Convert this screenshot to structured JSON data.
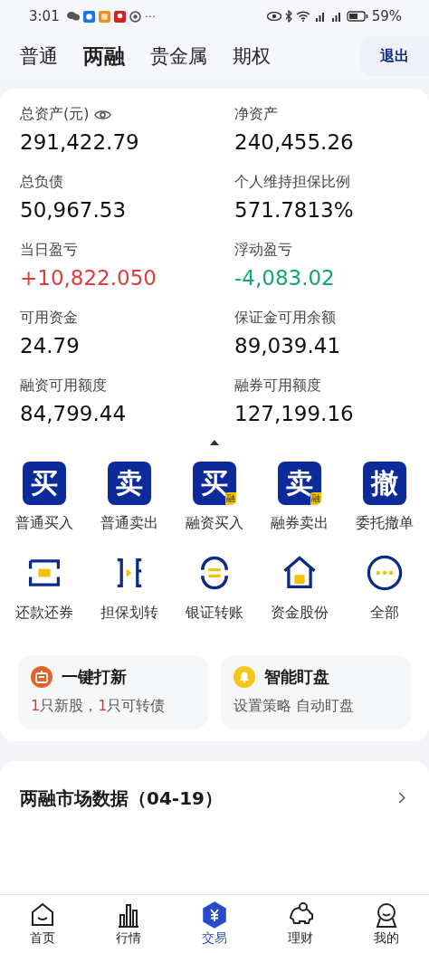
{
  "status_bar": {
    "time": "3:01",
    "more": "···",
    "battery": "59%"
  },
  "tabs": [
    {
      "label": "普通",
      "selected": false
    },
    {
      "label": "两融",
      "selected": true
    },
    {
      "label": "贵金属",
      "selected": false
    },
    {
      "label": "期权",
      "selected": false
    }
  ],
  "logout": "退出",
  "metrics": [
    {
      "label": "总资产(元)",
      "value": "291,422.79",
      "color": "#111111",
      "eye": true
    },
    {
      "label": "净资产",
      "value": "240,455.26",
      "color": "#111111",
      "eye": false
    },
    {
      "label": "总负债",
      "value": "50,967.53",
      "color": "#111111",
      "eye": false
    },
    {
      "label": "个人维持担保比例",
      "value": "571.7813%",
      "color": "#111111",
      "eye": false
    },
    {
      "label": "当日盈亏",
      "value": "+10,822.050",
      "color": "#e03c3c",
      "eye": false
    },
    {
      "label": "浮动盈亏",
      "value": "-4,083.02",
      "color": "#15a66f",
      "eye": false
    },
    {
      "label": "可用资金",
      "value": "24.79",
      "color": "#111111",
      "eye": false
    },
    {
      "label": "保证金可用余额",
      "value": "89,039.41",
      "color": "#111111",
      "eye": false
    },
    {
      "label": "融资可用额度",
      "value": "84,799.44",
      "color": "#111111",
      "eye": false
    },
    {
      "label": "融券可用额度",
      "value": "127,199.16",
      "color": "#111111",
      "eye": false
    }
  ],
  "actions": [
    {
      "kind": "glyph",
      "glyph": "买",
      "label": "普通买入"
    },
    {
      "kind": "glyph",
      "glyph": "卖",
      "label": "普通卖出"
    },
    {
      "kind": "glyph",
      "glyph": "买",
      "badge": "融",
      "label": "融资买入"
    },
    {
      "kind": "glyph",
      "glyph": "卖",
      "badge": "融",
      "label": "融券卖出"
    },
    {
      "kind": "glyph",
      "glyph": "撤",
      "label": "委托撤单"
    },
    {
      "kind": "repay",
      "label": "还款还券"
    },
    {
      "kind": "collateral",
      "label": "担保划转"
    },
    {
      "kind": "bank",
      "label": "银证转账"
    },
    {
      "kind": "assets",
      "label": "资金股份"
    },
    {
      "kind": "more",
      "label": "全部"
    }
  ],
  "tiles": [
    {
      "kind": "ipo",
      "title": "一键打新",
      "subtitle": [
        {
          "text": "1",
          "highlight": true
        },
        {
          "text": "只新股，",
          "highlight": false
        },
        {
          "text": "1",
          "highlight": true
        },
        {
          "text": "只可转债",
          "highlight": false
        }
      ]
    },
    {
      "kind": "alert",
      "title": "智能盯盘",
      "subtitle": [
        {
          "text": "设置策略 自动盯盘",
          "highlight": false
        }
      ]
    }
  ],
  "market_data": {
    "title": "两融市场数据（04-19）"
  },
  "nav": [
    {
      "kind": "home",
      "label": "首页",
      "selected": false
    },
    {
      "kind": "market",
      "label": "行情",
      "selected": false
    },
    {
      "kind": "trade",
      "label": "交易",
      "selected": true
    },
    {
      "kind": "wealth",
      "label": "理财",
      "selected": false
    },
    {
      "kind": "me",
      "label": "我的",
      "selected": false
    }
  ]
}
